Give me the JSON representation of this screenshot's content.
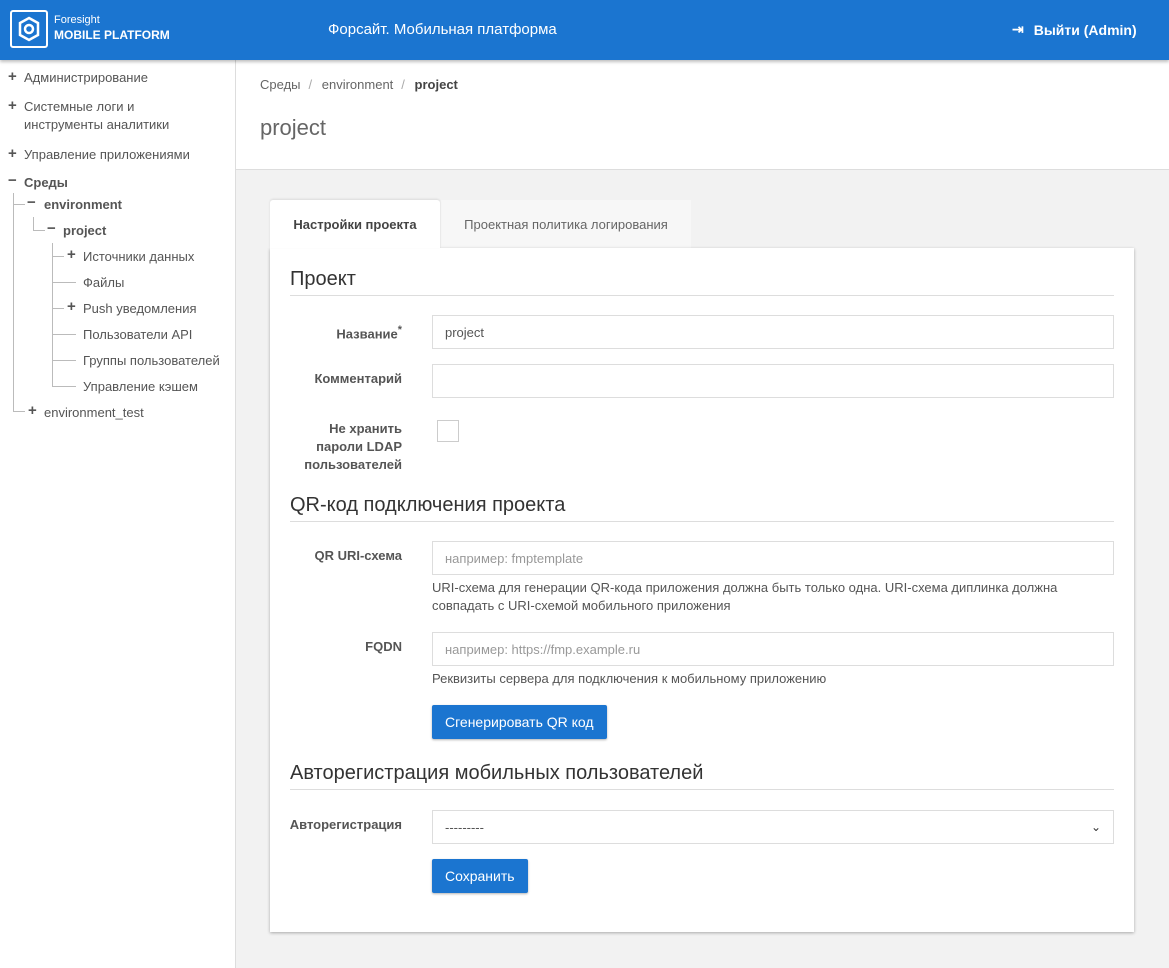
{
  "header": {
    "brand_top": "Foresight",
    "brand_bottom": "MOBILE PLATFORM",
    "title": "Форсайт. Мобильная платформа",
    "logout": "Выйти (Admin)"
  },
  "sidebar": {
    "items": [
      "Администрирование",
      "Системные логи и",
      "инструменты аналитики",
      "Управление приложениями",
      "Среды",
      "environment",
      "project",
      "Источники данных",
      "Файлы",
      "Push уведомления",
      "Пользователи API",
      "Группы пользователей",
      "Управление кэшем",
      "environment_test"
    ]
  },
  "breadcrumb": [
    "Среды",
    "environment",
    "project"
  ],
  "page_title": "project",
  "tabs": [
    "Настройки проекта",
    "Проектная политика логирования"
  ],
  "form": {
    "section_project": "Проект",
    "name_label": "Название",
    "required_mark": "*",
    "name_value": "project",
    "comment_label": "Комментарий",
    "comment_value": "",
    "ldap_label_1": "Не хранить",
    "ldap_label_2": "пароли LDAP",
    "ldap_label_3": "пользователей",
    "ldap_checked": false,
    "section_qr": "QR-код подключения проекта",
    "qr_label": "QR URI-схема",
    "qr_placeholder": "например: fmptemplate",
    "qr_help_1": "URI-схема для генерации QR-кода приложения должна быть только одна. URI-схема диплинка должна",
    "qr_help_2": "совпадать с URI-схемой мобильного приложения",
    "fqdn_label": "FQDN",
    "fqdn_placeholder": "например: https://fmp.example.ru",
    "fqdn_help": "Реквизиты сервера для подключения к мобильному приложению",
    "generate_button": "Сгенерировать QR код",
    "section_auto": "Авторегистрация мобильных пользователей",
    "auto_label": "Авторегистрация",
    "auto_value": "---------",
    "save_button": "Сохранить"
  }
}
